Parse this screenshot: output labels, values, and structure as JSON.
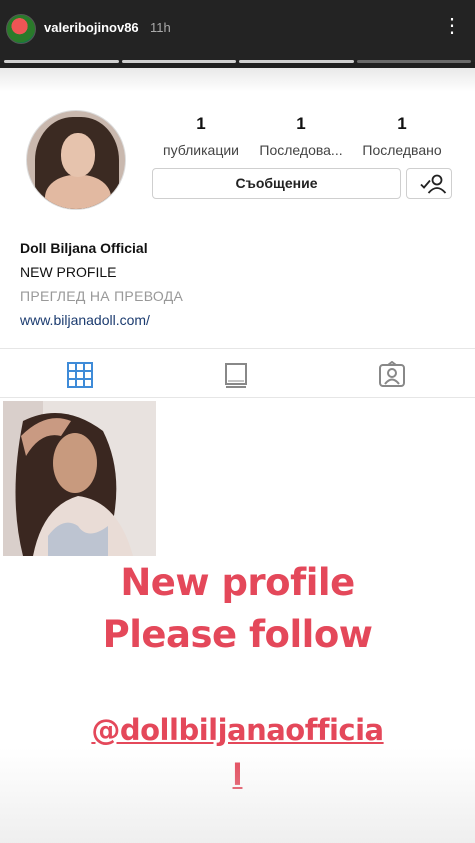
{
  "story": {
    "username": "valeribojinov86",
    "time_ago": "11h",
    "more_icon": "more-dots-icon",
    "segments": [
      true,
      true,
      true,
      false
    ]
  },
  "profile": {
    "stats": [
      {
        "count": "1",
        "label": "публикации"
      },
      {
        "count": "1",
        "label": "Последова..."
      },
      {
        "count": "1",
        "label": "Последвано"
      }
    ],
    "message_button": "Съобщение",
    "follow_icon": "person-check-icon",
    "name": "Doll Biljana Official",
    "bio": "NEW PROFILE",
    "translate": "ПРЕГЛЕД НА ПРЕВОДА",
    "link": "www.biljanadoll.com/"
  },
  "tabs": [
    {
      "icon": "grid-icon",
      "active": true
    },
    {
      "icon": "igtv-icon",
      "active": false
    },
    {
      "icon": "tagged-icon",
      "active": false
    }
  ],
  "overlay": {
    "line1": "New profile",
    "line2": "Please follow",
    "line3": "@dollbiljanaofficia",
    "line4": "l"
  },
  "colors": {
    "overlay_text": "#e4485a",
    "link": "#1b3b6f",
    "grid_icon_active": "#3e8bd8"
  }
}
